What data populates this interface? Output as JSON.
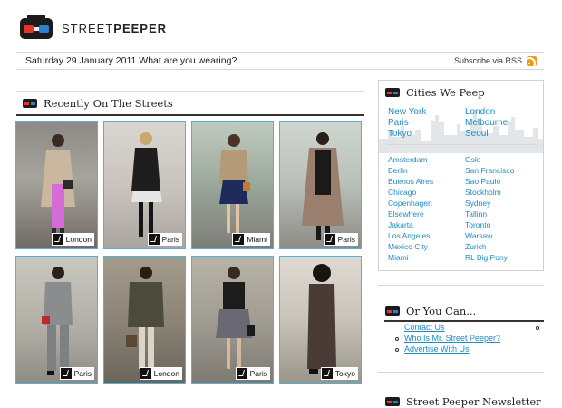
{
  "header": {
    "brand_light": "STREET",
    "brand_bold": "PEEPER"
  },
  "datebar": {
    "date": "Saturday 29 January 2011 What are you wearing?",
    "subscribe": "Subscribe via RSS"
  },
  "recent": {
    "title": "Recently On The Streets",
    "tiles": [
      {
        "city": "London"
      },
      {
        "city": "Paris"
      },
      {
        "city": "Miami"
      },
      {
        "city": "Paris"
      },
      {
        "city": "Paris"
      },
      {
        "city": "London"
      },
      {
        "city": "Paris"
      },
      {
        "city": "Tokyo"
      }
    ]
  },
  "cities": {
    "title": "Cities We Peep",
    "featured": [
      "New York",
      "London",
      "Paris",
      "Melbourne",
      "Tokyo",
      "Seoul"
    ],
    "others": [
      "Amsterdam",
      "Oslo",
      "Berlin",
      "San Francisco",
      "Buenos Aires",
      "Sao Paulo",
      "Chicago",
      "Stockholm",
      "Copenhagen",
      "Sydney",
      "Elsewhere",
      "Tallinn",
      "Jakarta",
      "Toronto",
      "Los Angeles",
      "Warsaw",
      "Mexico City",
      "Zurich",
      "Miami",
      "RL Big Pony"
    ]
  },
  "or_you_can": {
    "title": "Or You Can...",
    "links": [
      "Contact Us",
      "Who Is Mr. Street Peeper?",
      "Advertise With Us"
    ]
  },
  "newsletter": {
    "title": "Street Peeper Newsletter"
  },
  "colors": {
    "link": "#1e8bc3",
    "tile_border": "#4fb3d9",
    "rss": "#f39a1c"
  },
  "icons": [
    "viewmaster-logo-icon",
    "rss-icon",
    "camera-tag-icon"
  ]
}
